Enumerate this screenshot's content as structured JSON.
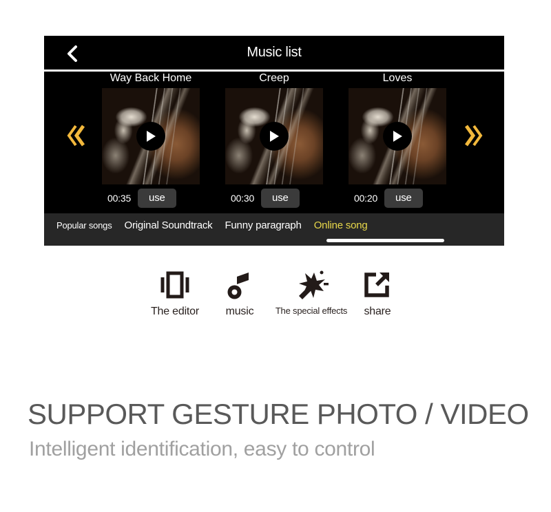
{
  "app": {
    "title": "Music list",
    "back_icon": "chevron-left-icon",
    "prev_icon": "double-chevron-left-icon",
    "next_icon": "double-chevron-right-icon",
    "accent_color": "#f2b83c",
    "active_tab_color": "#e8d84a"
  },
  "songs": [
    {
      "title": "Way Back Home",
      "duration": "00:35",
      "use_label": "use",
      "play_icon": "play-icon"
    },
    {
      "title": "Creep",
      "duration": "00:30",
      "use_label": "use",
      "play_icon": "play-icon"
    },
    {
      "title": "Loves",
      "duration": "00:20",
      "use_label": "use",
      "play_icon": "play-icon"
    }
  ],
  "tabs": [
    {
      "label": "Popular songs",
      "active": false
    },
    {
      "label": "Original Soundtrack",
      "active": false
    },
    {
      "label": "Funny paragraph",
      "active": false
    },
    {
      "label": "Online song",
      "active": true
    }
  ],
  "features": [
    {
      "label": "The editor",
      "icon": "editor-icon"
    },
    {
      "label": "music",
      "icon": "music-note-icon"
    },
    {
      "label": "The special effects",
      "icon": "magic-wand-icon"
    },
    {
      "label": "share",
      "icon": "share-icon"
    }
  ],
  "marketing": {
    "headline": "SUPPORT GESTURE PHOTO / VIDEO",
    "subheadline": "Intelligent identification, easy to control"
  }
}
